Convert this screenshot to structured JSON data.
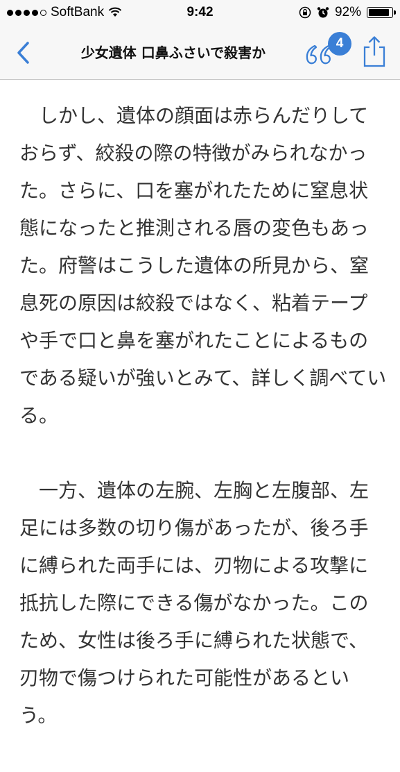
{
  "status_bar": {
    "carrier": "SoftBank",
    "time": "9:42",
    "battery_percent": "92%",
    "battery_level": 0.92
  },
  "nav": {
    "title": "少女遺体 口鼻ふさいで殺害か",
    "badge_count": "4",
    "accent_color": "#3a7fd6"
  },
  "article": {
    "paragraphs": [
      "しかし、遺体の顔面は赤らんだりしておらず、絞殺の際の特徴がみられなかった。さらに、口を塞がれたために窒息状態になったと推測される唇の変色もあった。府警はこうした遺体の所見から、窒息死の原因は絞殺ではなく、粘着テープや手で口と鼻を塞がれたことによるものである疑いが強いとみて、詳しく調べている。",
      "一方、遺体の左腕、左胸と左腹部、左足には多数の切り傷があったが、後ろ手に縛られた両手には、刃物による攻撃に抵抗した際にできる傷がなかった。このため、女性は後ろ手に縛られた状態で、刃物で傷つけられた可能性があるという。"
    ]
  }
}
